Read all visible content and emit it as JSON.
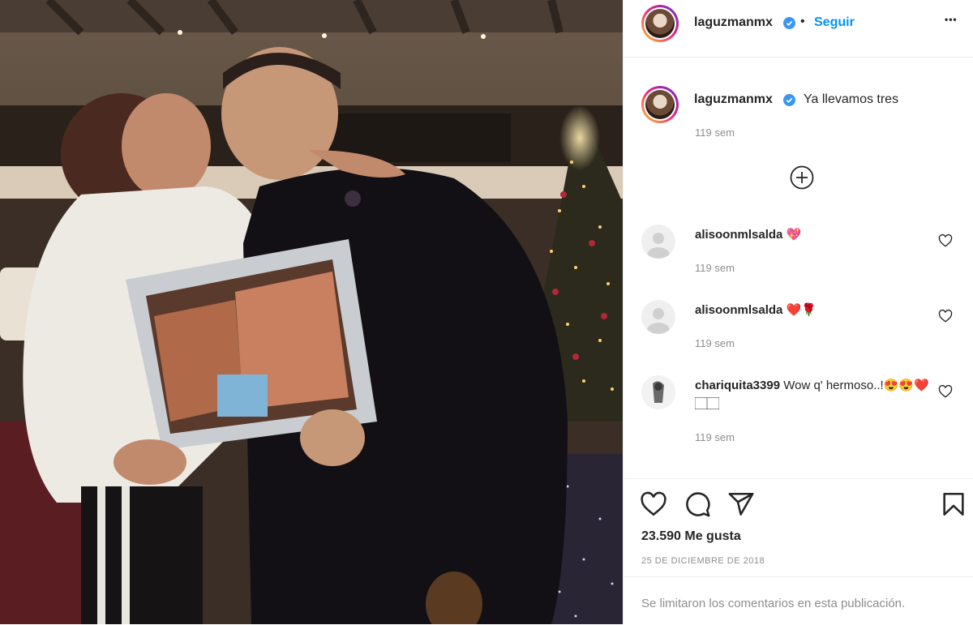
{
  "post": {
    "username": "laguzmanmx",
    "follow_label": "Seguir",
    "separator": "•",
    "more_label": "•••",
    "caption": "Ya llevamos tres",
    "caption_time": "119 sem"
  },
  "comments": [
    {
      "username": "alisoonmlsalda",
      "text": "💖",
      "time": "119 sem"
    },
    {
      "username": "alisoonmlsalda",
      "text": "❤️🌹",
      "time": "119 sem"
    },
    {
      "username": "chariquita3399",
      "text": "Wow q' hermoso..!😍😍❤️🏻🏻",
      "time": "119 sem"
    }
  ],
  "actions": {
    "likes": "23.590 Me gusta",
    "date": "25 DE DICIEMBRE DE 2018",
    "comments_limited": "Se limitaron los comentarios en esta publicación."
  },
  "colors": {
    "accent": "#0095f6",
    "verified": "#3897f0",
    "text": "#262626",
    "muted": "#8e8e8e"
  },
  "icons": [
    "verified-badge-icon",
    "add-comments-icon",
    "heart-icon",
    "comment-icon",
    "share-icon",
    "save-icon"
  ]
}
